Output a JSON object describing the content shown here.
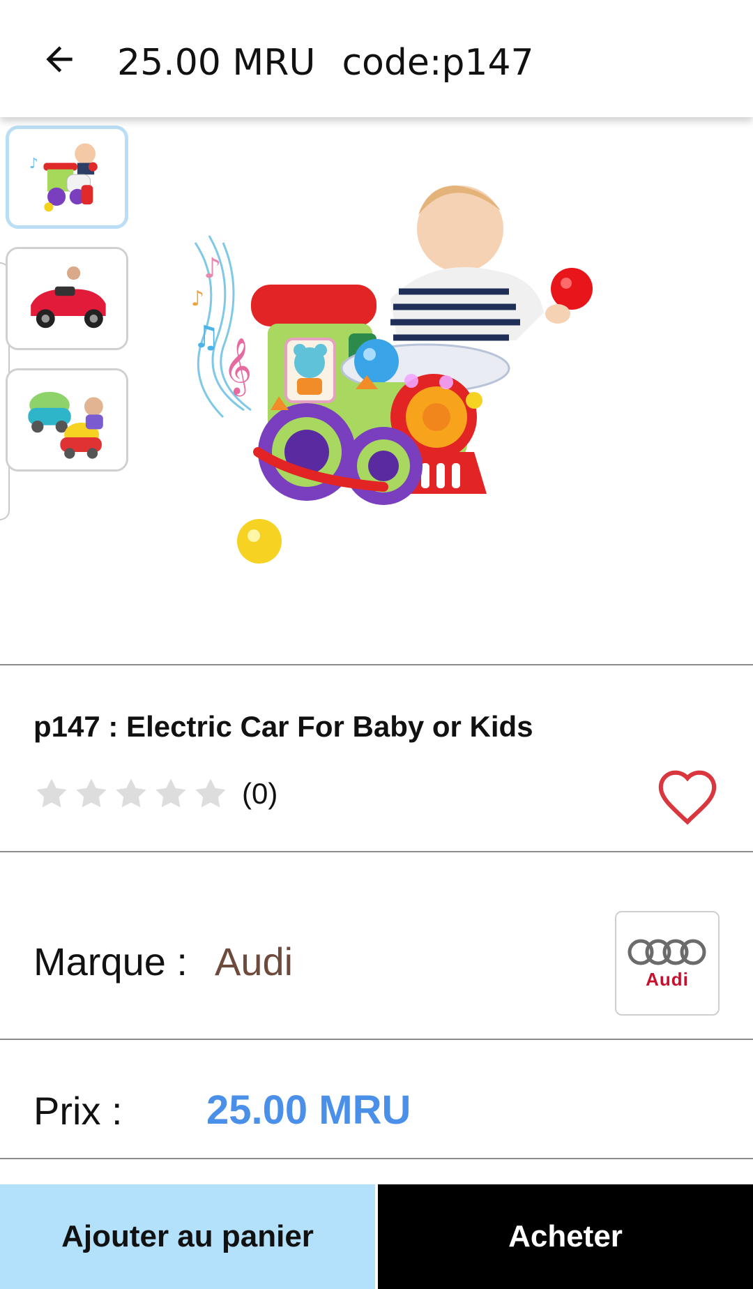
{
  "header": {
    "back_icon": "arrow-left-icon",
    "price": "25.00 MRU",
    "code": "code:p147"
  },
  "gallery": {
    "thumbnails": [
      {
        "name": "toy-train-with-baby",
        "selected": true
      },
      {
        "name": "red-ride-on-car-with-child",
        "selected": false
      },
      {
        "name": "toy-cars-with-baby",
        "selected": false
      }
    ],
    "main_image": "toy-train-with-baby"
  },
  "product": {
    "title": "p147 : Electric Car For Baby or Kids",
    "rating_stars": 0,
    "rating_max": 5,
    "rating_count": "(0)",
    "favorite_icon": "heart-outline-icon"
  },
  "brand": {
    "label": "Marque :",
    "value": "Audi",
    "logo_text": "Audi"
  },
  "price": {
    "label": "Prix :",
    "value": "25.00 MRU"
  },
  "actions": {
    "add_to_cart": "Ajouter au panier",
    "buy": "Acheter"
  },
  "colors": {
    "accent_price": "#4a90e8",
    "brand_text": "#6d4a3c",
    "cart_button_bg": "#b3e0fa",
    "buy_button_bg": "#000000",
    "favorite_heart": "#d9363e",
    "star_empty": "#dddddd"
  }
}
